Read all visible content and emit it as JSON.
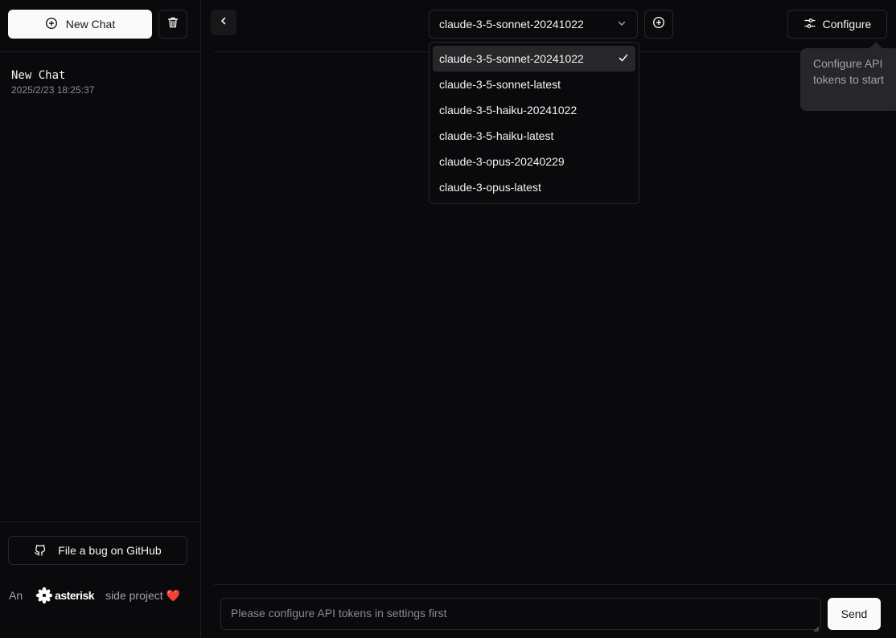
{
  "sidebar": {
    "new_chat_label": "New Chat",
    "chats": [
      {
        "title": "New Chat",
        "time": "2025/2/23 18:25:37"
      }
    ],
    "github_label": "File a bug on GitHub",
    "footer": {
      "prefix": "An",
      "brand": "asterisk",
      "suffix": "side project",
      "heart": "❤️"
    }
  },
  "header": {
    "model_selected": "claude-3-5-sonnet-20241022",
    "configure_label": "Configure",
    "tooltip": "Configure API tokens to start"
  },
  "model_dropdown": {
    "options": [
      "claude-3-5-sonnet-20241022",
      "claude-3-5-sonnet-latest",
      "claude-3-5-haiku-20241022",
      "claude-3-5-haiku-latest",
      "claude-3-opus-20240229",
      "claude-3-opus-latest"
    ]
  },
  "composer": {
    "placeholder": "Please configure API tokens in settings first",
    "send_label": "Send"
  },
  "colors": {
    "background": "#0a0a0c",
    "border": "#27272a",
    "primary_button": "#fafafa",
    "muted_text": "#8a8a93",
    "heart": "#ef4444"
  }
}
